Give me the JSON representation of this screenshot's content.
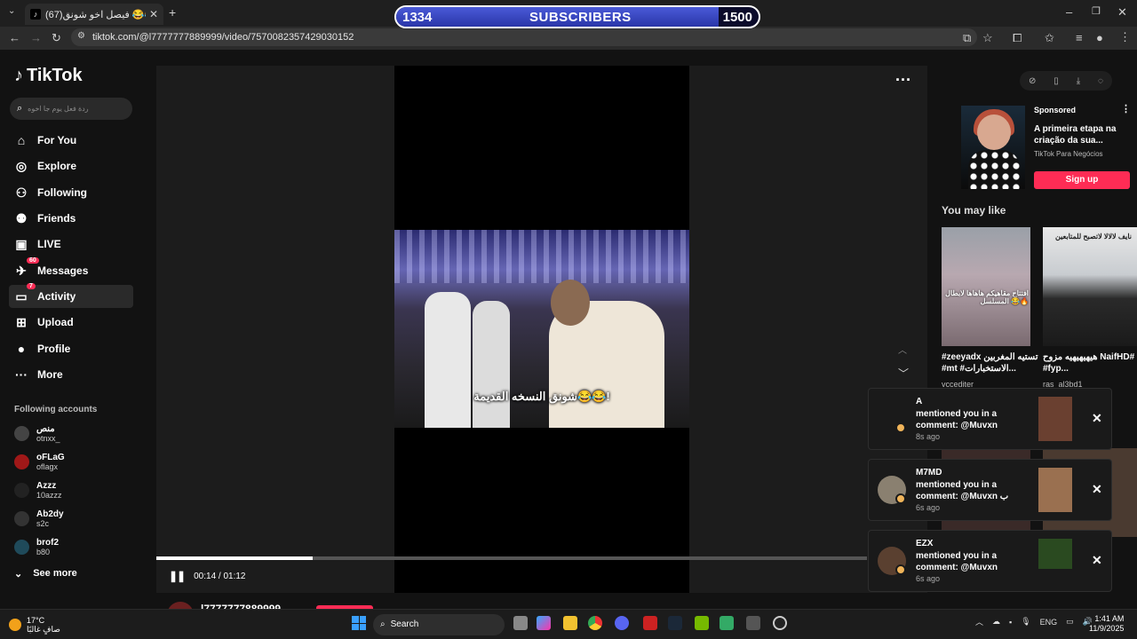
{
  "browser": {
    "tab_title": "(67)فيصل اخو شونق 😂😂🔊",
    "url": "tiktok.com/@l7777777889999/video/7570082357429030152",
    "new_tab": "+",
    "close_tab": "✕"
  },
  "overlay": {
    "subscribers_label": "SUBSCRIBERS",
    "current": "1334",
    "goal": "1500",
    "progress_fraction": 0.889
  },
  "sidebar": {
    "logo": "TikTok",
    "search_placeholder": "ردة فعل يوم جا اخوه",
    "nav": [
      {
        "label": "For You",
        "icon": "home-icon"
      },
      {
        "label": "Explore",
        "icon": "compass-icon"
      },
      {
        "label": "Following",
        "icon": "following-icon"
      },
      {
        "label": "Friends",
        "icon": "friends-icon"
      },
      {
        "label": "LIVE",
        "icon": "live-icon"
      },
      {
        "label": "Messages",
        "icon": "messages-icon",
        "badge": "60"
      },
      {
        "label": "Activity",
        "icon": "activity-icon",
        "badge": "7"
      },
      {
        "label": "Upload",
        "icon": "upload-icon"
      },
      {
        "label": "Profile",
        "icon": "profile-icon"
      },
      {
        "label": "More",
        "icon": "more-icon"
      }
    ],
    "following_title": "Following accounts",
    "accounts": [
      {
        "name": "منص",
        "handle": "otnxx_"
      },
      {
        "name": "oFLaG",
        "handle": "oflagx"
      },
      {
        "name": "Azzz",
        "handle": "10azzz"
      },
      {
        "name": "Ab2dy",
        "handle": "s2c"
      },
      {
        "name": "brof2",
        "handle": "b80"
      }
    ],
    "see_more": "See more"
  },
  "video": {
    "caption": "شونق النسخه القديمة😂😂!",
    "time": "00:14 / 01:12",
    "progress_fraction": 0.22,
    "author": "l7777777889999"
  },
  "ad": {
    "sponsored": "Sponsored",
    "title": "A primeira etapa na criação da sua...",
    "subtitle": "TikTok Para Negócios",
    "cta": "Sign up"
  },
  "you_may_like": {
    "title": "You may like",
    "items": [
      {
        "caption": "#zeeyadx تستيه المغربين #mt #الاستخبارات...",
        "user": "vccediter",
        "overlay": "افتتاح مقاهيكم هاهاها لابطال المسلسل 😂🔥"
      },
      {
        "caption": "هيهيهيهيه مزوح NaifHD# #fyp...",
        "user": "ras_al3bd1",
        "overlay": "نايف لالالا لاتصبح للمتابعين"
      }
    ]
  },
  "notifications": [
    {
      "who": "A",
      "msg": "mentioned you in a comment: @Muvxn",
      "time": "8s ago"
    },
    {
      "who": "M7MD",
      "msg": "mentioned you in a comment: @Muvxn ب",
      "time": "6s ago"
    },
    {
      "who": "EZX",
      "msg": "mentioned you in a comment: @Muvxn",
      "time": "6s ago"
    }
  ],
  "taskbar": {
    "temp": "17°C",
    "weather": "صافٍ غالبًا",
    "search": "Search",
    "lang": "ENG",
    "time": "1:41 AM",
    "date": "11/9/2025"
  },
  "colors": {
    "accent": "#fe2c55",
    "sub_fill": "#3a46c0"
  }
}
